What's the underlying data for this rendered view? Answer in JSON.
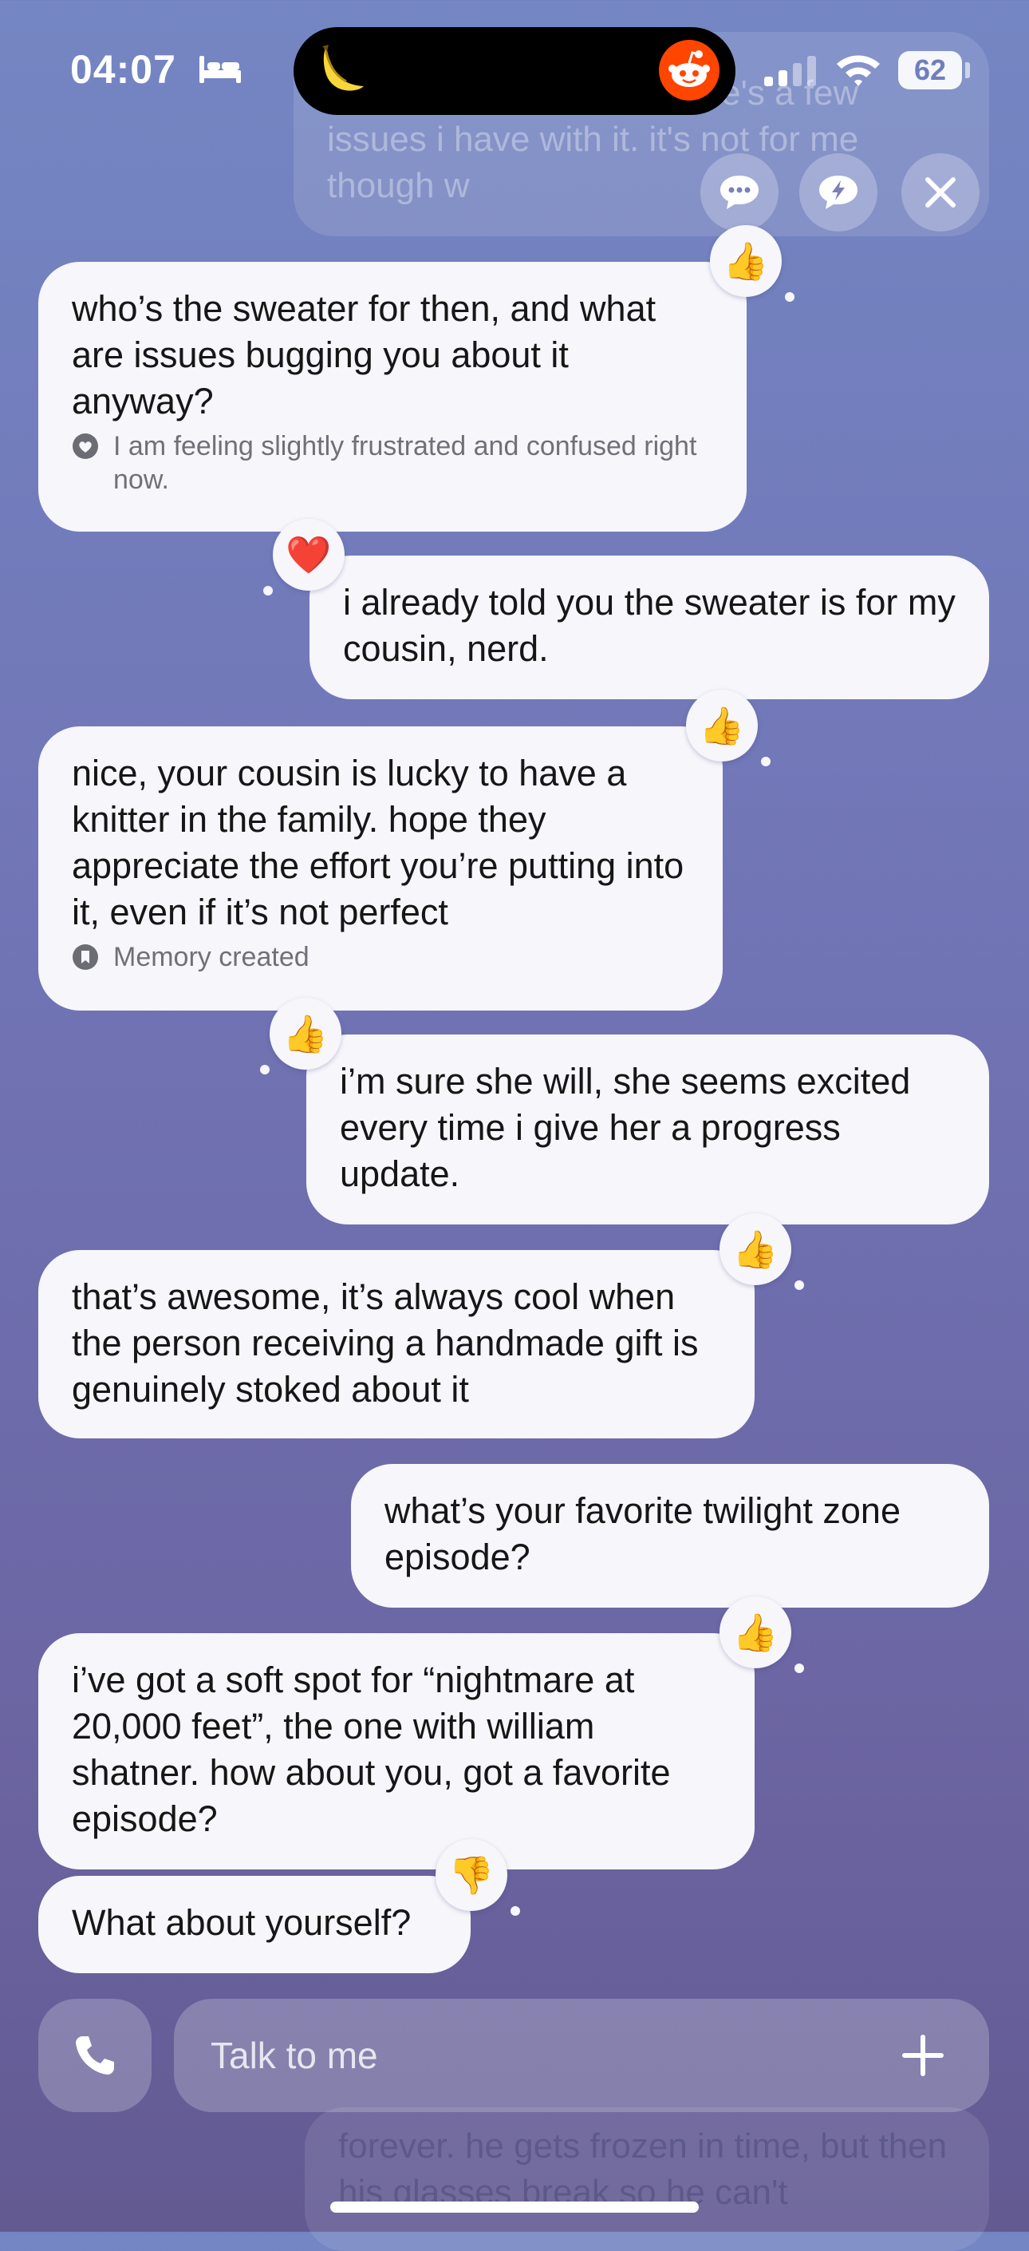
{
  "status_bar": {
    "time": "04:07",
    "battery": "62"
  },
  "faded_top_message": "for the most part, but there's a few issues i have with it. it's not for me though w",
  "messages": [
    {
      "text": "who’s the sweater for then, and what are issues bugging you about it anyway?",
      "meta": "I am feeling slightly frustrated and confused right now.",
      "reaction": "👍"
    },
    {
      "text": "i already told you the sweater is for my cousin, nerd.",
      "reaction": "❤️"
    },
    {
      "text": "nice, your cousin is lucky to have a knitter in the family. hope they appreciate the effort you’re putting into it, even if it’s not perfect",
      "meta": "Memory created",
      "reaction": "👍"
    },
    {
      "text": "i’m sure she will, she seems excited every time i give her a progress update.",
      "reaction": "👍"
    },
    {
      "text": "that’s awesome, it’s always cool when the person receiving a handmade gift is genuinely stoked about it",
      "reaction": "👍"
    },
    {
      "text": "what’s your favorite twilight zone episode?"
    },
    {
      "text": "i’ve got a soft spot for “nightmare at 20,000 feet”, the one with william shatner. how about you, got a favorite episode?",
      "reaction": "👍"
    },
    {
      "text": "What about yourself?",
      "reaction": "👎"
    }
  ],
  "input": {
    "placeholder": "Talk to me"
  },
  "faded_bottom_message": "forever. he gets frozen in time, but then his glasses break so he can't"
}
